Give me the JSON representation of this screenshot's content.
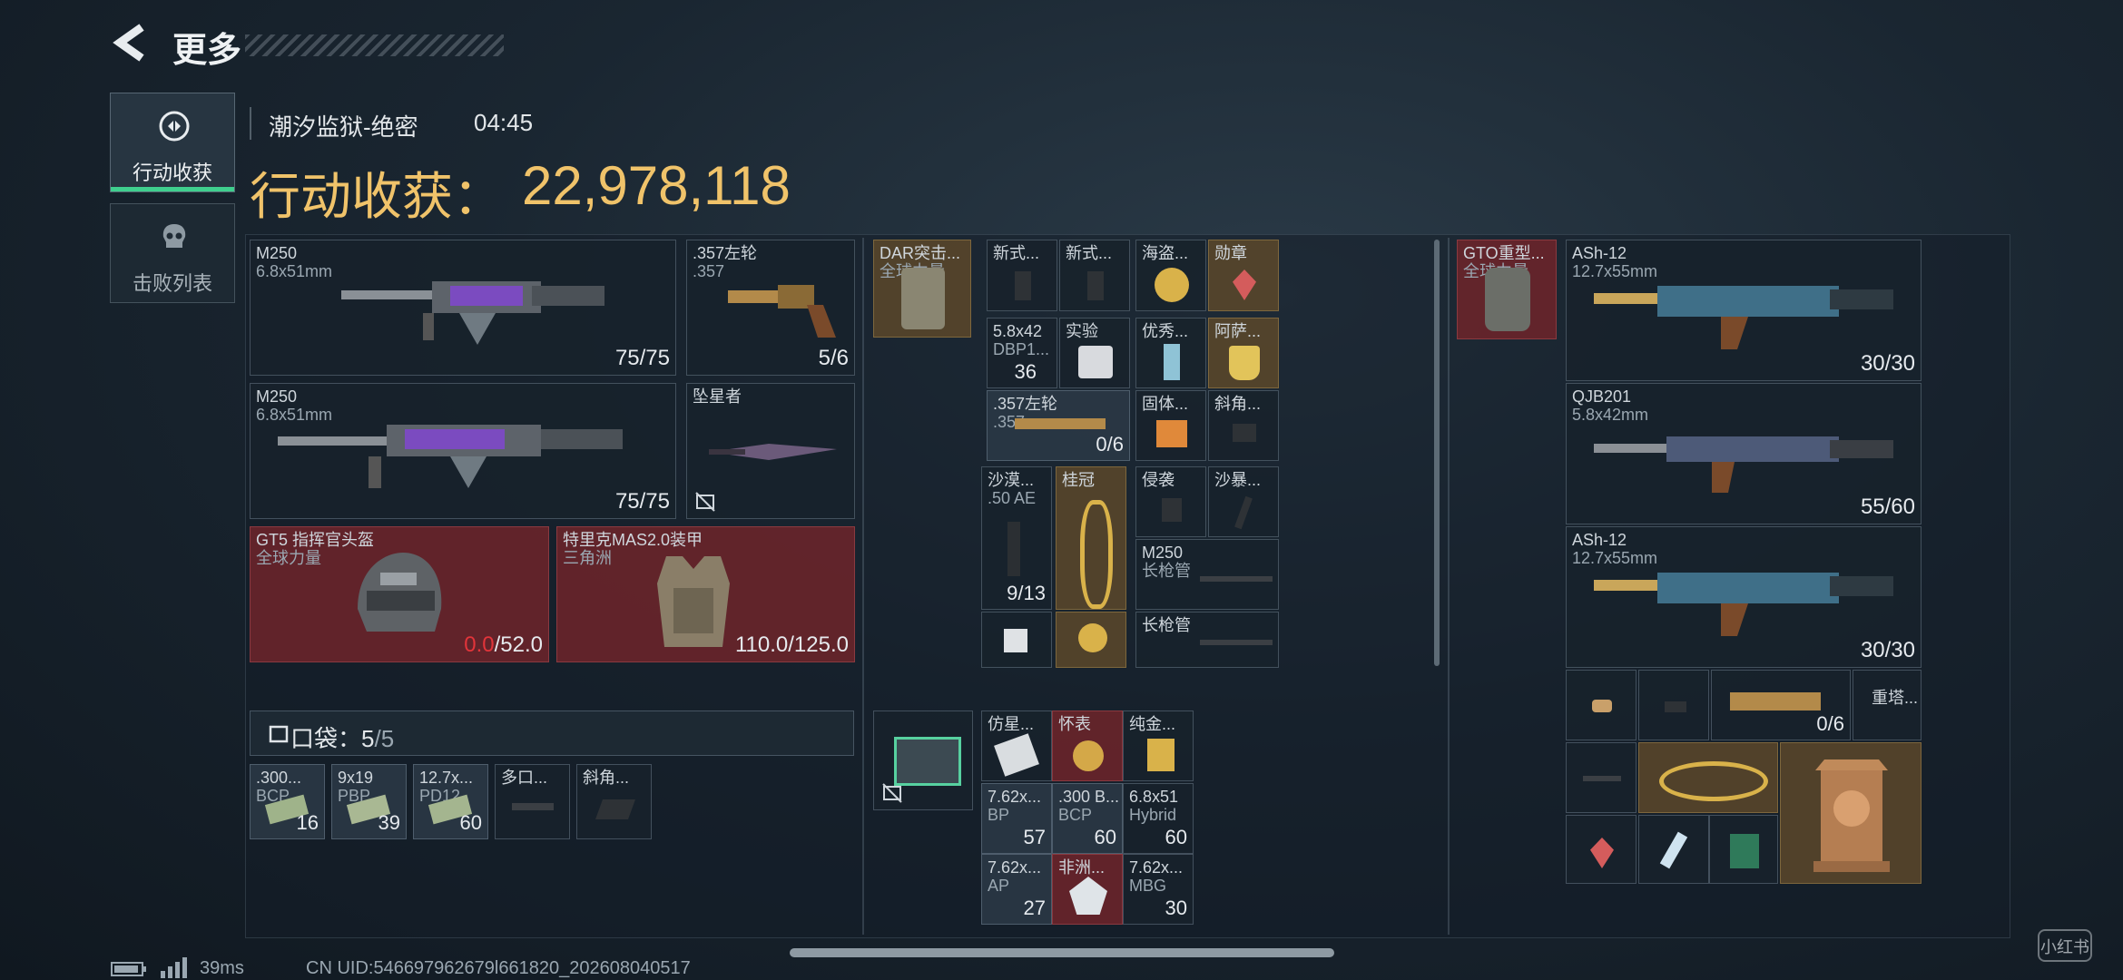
{
  "header": {
    "back_label": "更多"
  },
  "sidebar": {
    "tab_loot_label": "行动收获",
    "tab_kills_label": "击败列表"
  },
  "match": {
    "map_name": "潮汐监狱-绝密",
    "time": "04:45",
    "value_label": "行动收获：",
    "value": "22,978,118"
  },
  "pouch": {
    "label": "口袋：",
    "count_current": "5",
    "count_sep": "/",
    "count_max": "5"
  },
  "status": {
    "ping": "39ms",
    "uid": "CN UID:546697962679l661820_202608040517",
    "watermark": "小红书"
  },
  "gear": {
    "weapon1": {
      "name": "M250",
      "caliber": "6.8x51mm",
      "ammo": "75/75"
    },
    "weapon2": {
      "name": "M250",
      "caliber": "6.8x51mm",
      "ammo": "75/75"
    },
    "revolver": {
      "name": ".357左轮",
      "caliber": ".357",
      "ammo": "5/6"
    },
    "melee": {
      "name": "坠星者"
    },
    "helmet": {
      "name": "GT5 指挥官头盔",
      "brand": "全球力量",
      "dur_current": "0.0",
      "dur_max": "/52.0"
    },
    "armor": {
      "name": "特里克MAS2.0装甲",
      "brand": "三角洲",
      "durability": "110.0/125.0"
    }
  },
  "pockets": [
    {
      "name": ".300...",
      "sub": "BCP...",
      "count": "16"
    },
    {
      "name": "9x19",
      "sub": "PBP",
      "count": "39"
    },
    {
      "name": "12.7x...",
      "sub": "PD12",
      "count": "60"
    },
    {
      "name": "多口..."
    },
    {
      "name": "斜角..."
    }
  ],
  "rig": {
    "name": "DAR突击...",
    "brand": "全球力量",
    "items": {
      "a1": "新式...",
      "a2": "新式...",
      "a3": "海盗...",
      "a4": "勋章",
      "b1": "5.8x42",
      "b1sub": "DBP1...",
      "b1cnt": "36",
      "b2": "实验",
      "b3": "优秀...",
      "b4": "阿萨...",
      "c1": ".357左轮",
      "c1sub": ".357",
      "c1cnt": "0/6",
      "c3": "固体...",
      "c4": "斜角...",
      "d1": "沙漠...",
      "d1sub": ".50 AE",
      "d1cnt": "9/13",
      "d2": "桂冠",
      "d3": "侵袭",
      "d4": "沙暴...",
      "e3": "M250",
      "e3sub": "长枪管",
      "f3": "长枪管"
    }
  },
  "bag": {
    "items": {
      "r1c1": "仿星...",
      "r1c2": "怀表",
      "r1c3": "纯金...",
      "r2c1": "7.62x...",
      "r2c1sub": "BP",
      "r2c1cnt": "57",
      "r2c2": ".300 B...",
      "r2c2sub": "BCP",
      "r2c2cnt": "60",
      "r2c3": "6.8x51",
      "r2c3sub": "Hybrid",
      "r2c3cnt": "60",
      "r3c1": "7.62x...",
      "r3c1sub": "AP",
      "r3c1cnt": "27",
      "r3c2": "非洲...",
      "r3c3": "7.62x...",
      "r3c3sub": "MBG",
      "r3c3cnt": "30"
    }
  },
  "backpack": {
    "name": "GTO重型...",
    "brand": "全球力量",
    "weapons": [
      {
        "name": "ASh-12",
        "caliber": "12.7x55mm",
        "ammo": "30/30"
      },
      {
        "name": "QJB201",
        "caliber": "5.8x42mm",
        "ammo": "55/60"
      },
      {
        "name": "ASh-12",
        "caliber": "12.7x55mm",
        "ammo": "30/30"
      }
    ],
    "row4_ammo": "0/6",
    "row4_name": "重塔..."
  },
  "colors": {
    "gold": "#f0c36a",
    "red": "#e2343a",
    "accent_green": "#3fcf8e"
  }
}
